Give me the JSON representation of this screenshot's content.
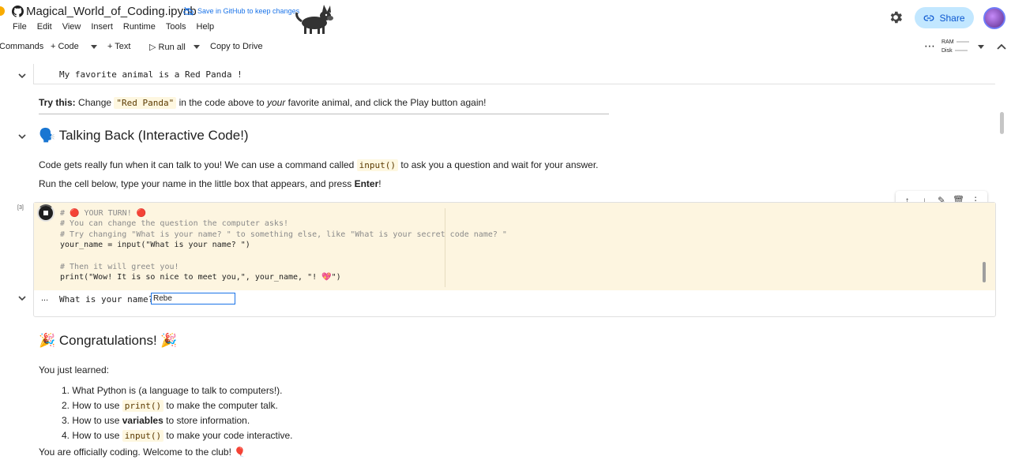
{
  "header": {
    "title": "Magical_World_of_Coding.ipynb",
    "save_github": "Save in GitHub to keep changes",
    "share_label": "Share",
    "menu": [
      "File",
      "Edit",
      "View",
      "Insert",
      "Runtime",
      "Tools",
      "Help"
    ]
  },
  "toolbar": {
    "commands": "Commands",
    "code": "Code",
    "text": "Text",
    "run_all": "Run all",
    "copy_to_drive": "Copy to Drive",
    "ram": "RAM",
    "disk": "Disk"
  },
  "notebook": {
    "prev_output": "My favorite animal is a Red Panda !",
    "try_this": {
      "bold": "Try this:",
      "t1": " Change ",
      "code": "\"Red Panda\"",
      "t2": " in the code above to ",
      "italic": "your",
      "t3": " favorite animal, and click the Play button again!"
    },
    "talk_heading": "🗣️ Talking Back (Interactive Code!)",
    "code_fun": {
      "t1": "Code gets really fun when it can talk to you! We can use a command called ",
      "code": "input()",
      "t2": " to ask you a question and wait for your answer."
    },
    "run_cell": {
      "t1": "Run the cell below, type your name in the little box that appears, and press ",
      "bold": "Enter",
      "t2": "!"
    },
    "exec_count": "[3]",
    "code_lines": [
      "# 🔴 YOUR TURN! 🔴",
      "# You can change the question the computer asks!",
      "# Try changing \"What is your name? \" to something else, like \"What is your secret code name? \"",
      "your_name = input(\"What is your name? \")",
      "",
      "# Then it will greet you!",
      "print(\"Wow! It is so nice to meet you,\", your_name, \"! 💖\")"
    ],
    "output_dots": "...",
    "prompt": "What is your name?",
    "input_value": "Rebe",
    "congrats_heading": "🎉 Congratulations! 🎉",
    "learned": "You just learned:",
    "list": [
      {
        "n": "1.",
        "t1": "What Python is (a language to talk to computers!).",
        "code": "",
        "bold": "",
        "t2": ""
      },
      {
        "n": "2.",
        "t1": "How to use ",
        "code": "print()",
        "bold": "",
        "t2": " to make the computer talk."
      },
      {
        "n": "3.",
        "t1": "How to use ",
        "code": "",
        "bold": "variables",
        "t2": " to store information."
      },
      {
        "n": "4.",
        "t1": "How to use ",
        "code": "input()",
        "bold": "",
        "t2": " to make your code interactive."
      }
    ],
    "welcome": "You are officially coding. Welcome to the club! 🎈"
  },
  "colors": {
    "accent": "#1a73e8",
    "share_bg": "#c2e7ff",
    "code_bg": "#fdf5e0"
  }
}
